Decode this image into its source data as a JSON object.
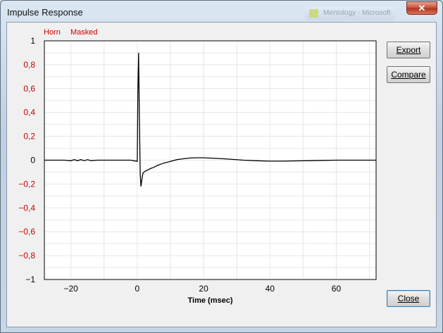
{
  "window": {
    "title": "Impulse Response",
    "close_glyph": "✕",
    "background_task_label": "Mentology - Microsoft"
  },
  "legend": {
    "items": [
      {
        "label": "Horn",
        "color": "#cc0000"
      },
      {
        "label": "Masked",
        "color": "#cc0000"
      }
    ]
  },
  "buttons": {
    "export_label": "Export",
    "compare_label": "Compare",
    "close_label": "Close"
  },
  "colors": {
    "tick_label_red": "#cc0000",
    "tick_label_black": "#000000",
    "trace": "#000000",
    "grid": "#e6e6e6"
  },
  "chart_data": {
    "type": "line",
    "title": "",
    "xlabel": "Time (msec)",
    "ylabel": "",
    "xlim": [
      -28,
      72
    ],
    "ylim": [
      -1,
      1
    ],
    "grid": true,
    "x_ticks": [
      -20,
      0,
      20,
      40,
      60
    ],
    "x_tick_labels": [
      "−20",
      "0",
      "20",
      "40",
      "60"
    ],
    "y_ticks": [
      1,
      0.8,
      0.6,
      0.4,
      0.2,
      0,
      -0.2,
      -0.4,
      -0.6,
      -0.8,
      -1
    ],
    "y_tick_labels": [
      "1",
      "0,8",
      "0,6",
      "0,4",
      "0,2",
      "0",
      "−0,2",
      "−0,4",
      "−0,6",
      "−0,8",
      "−1"
    ],
    "y_tick_label_colors": [
      "black",
      "red",
      "red",
      "red",
      "red",
      "black",
      "red",
      "red",
      "red",
      "red",
      "black"
    ],
    "series": [
      {
        "x": [
          -28,
          -22,
          -20,
          -19,
          -18,
          -17,
          -16,
          -15,
          -14,
          -12,
          -10,
          -6,
          -2,
          0,
          0.2,
          0.4,
          0.6,
          0.9,
          1.1,
          1.4,
          1.7,
          2.0,
          2.5,
          3,
          4,
          5,
          6,
          8,
          10,
          12,
          14,
          16,
          18,
          20,
          24,
          28,
          32,
          36,
          40,
          44,
          48,
          52,
          56,
          60,
          64,
          68,
          72
        ],
        "y": [
          0,
          0,
          -0.005,
          0.005,
          -0.005,
          0.005,
          -0.004,
          0.004,
          -0.004,
          0,
          0,
          0,
          0,
          -0.01,
          0.6,
          0.9,
          0.45,
          -0.12,
          -0.22,
          -0.16,
          -0.11,
          -0.1,
          -0.09,
          -0.085,
          -0.07,
          -0.06,
          -0.045,
          -0.025,
          -0.01,
          0.005,
          0.012,
          0.018,
          0.02,
          0.02,
          0.015,
          0.008,
          0.0,
          -0.005,
          -0.008,
          -0.008,
          -0.006,
          -0.004,
          -0.002,
          0,
          0,
          0,
          0
        ]
      }
    ]
  }
}
